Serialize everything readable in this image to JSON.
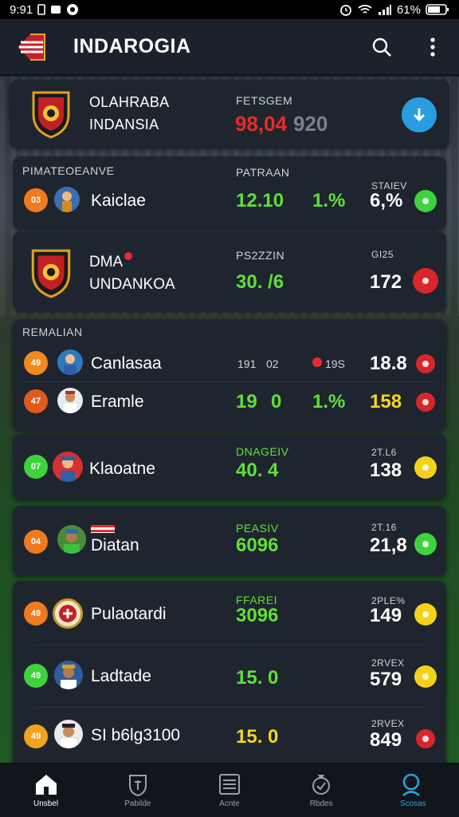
{
  "status": {
    "time": "9:91",
    "battery": "61%"
  },
  "app": {
    "title": "INDAROGIA"
  },
  "match": {
    "team_line1": "OLAHRABA",
    "team_line2": "INDANSIA",
    "header": "FETSGEM",
    "score_red": "98,04",
    "score_gray": "920"
  },
  "section1": {
    "label": "PIMATEOEANVE",
    "col_a": "PATRAAN",
    "col_b": "STAIEV",
    "row": {
      "rank": "03",
      "name": "Kaiclae",
      "v1": "12.10",
      "v2": "1.%",
      "v3": "6,%"
    }
  },
  "team2": {
    "name1": "DMA",
    "name2": "UNDANKOA",
    "col_a": "PS2ZZIN",
    "col_b": "GI25",
    "v1": "30. /6",
    "v3": "172"
  },
  "section2": {
    "label": "REMALIAN",
    "rows": [
      {
        "rank": "49",
        "name": "Canlasaa",
        "v1a": "191",
        "v1b": "02",
        "vmid": "19S",
        "v3": "18.8"
      },
      {
        "rank": "47",
        "name": "Eramle",
        "v1a": "19",
        "v1b": "0",
        "vmid": "1.%",
        "v3": "158"
      }
    ]
  },
  "card_k": {
    "rank": "07",
    "name": "Klaoatne",
    "header": "DNAGEIV",
    "v1": "40. 4",
    "col_b": "2T.L6",
    "v3": "138"
  },
  "card_d": {
    "rank": "04",
    "name": "Diatan",
    "header": "PEASIV",
    "v1": "6096",
    "col_b": "2T.16",
    "v3": "21,8"
  },
  "list": {
    "rows": [
      {
        "rank": "49",
        "name": "Pulaotardi",
        "header": "FFAREI",
        "v1": "3096",
        "col_b": "2PLE%",
        "v3": "149"
      },
      {
        "rank": "49",
        "name": "Ladtade",
        "header": "",
        "v1": "15. 0",
        "col_b": "2RVEX",
        "v3": "579"
      },
      {
        "rank": "49",
        "name": "SI b6lg3100",
        "header": "",
        "v1": "15. 0",
        "col_b": "2RVEX",
        "v3": "849"
      }
    ]
  },
  "nav": [
    {
      "label": "Unsbel",
      "icon": "home-icon"
    },
    {
      "label": "Pabilde",
      "icon": "shield-icon"
    },
    {
      "label": "Acnte",
      "icon": "list-icon"
    },
    {
      "label": "Rbdes",
      "icon": "medal-icon"
    },
    {
      "label": "Scosas",
      "icon": "search-icon"
    }
  ],
  "colors": {
    "accent": "#2ea0e0",
    "green": "#5ee03a",
    "yellow": "#f5d51f",
    "red": "#e82c2c"
  }
}
